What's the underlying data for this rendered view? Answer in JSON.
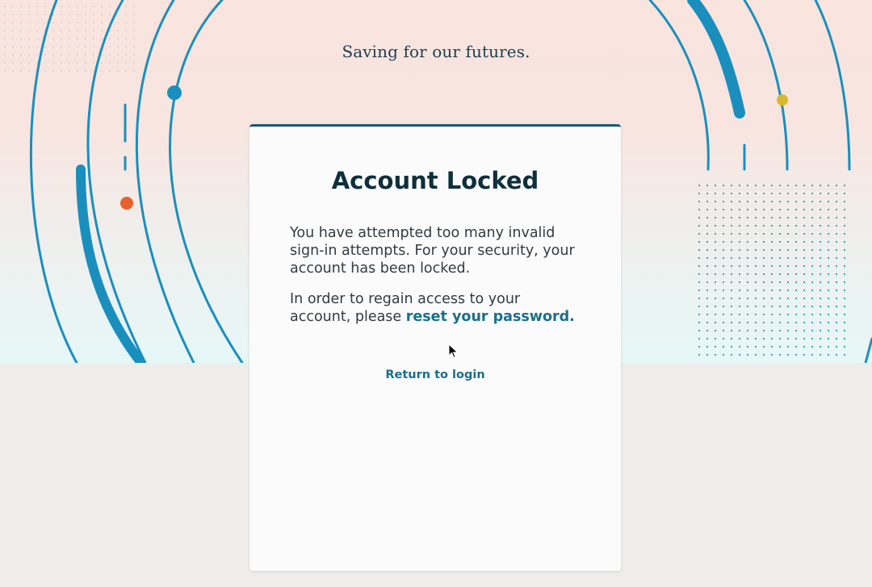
{
  "hero": {
    "tagline": "Saving for our futures."
  },
  "card": {
    "title": "Account Locked",
    "paragraph1": "You have attempted too many invalid sign-in attempts. For your security, your account has been locked.",
    "paragraph2_prefix": "In order to regain access to your account, please ",
    "reset_link": "reset your password.",
    "return_link": "Return to login"
  },
  "colors": {
    "accent": "#1a6f8e",
    "ring": "#1a8fbd",
    "card_border": "#165a7c",
    "dot_orange": "#e8612c",
    "dot_yellow": "#d8b92c"
  }
}
